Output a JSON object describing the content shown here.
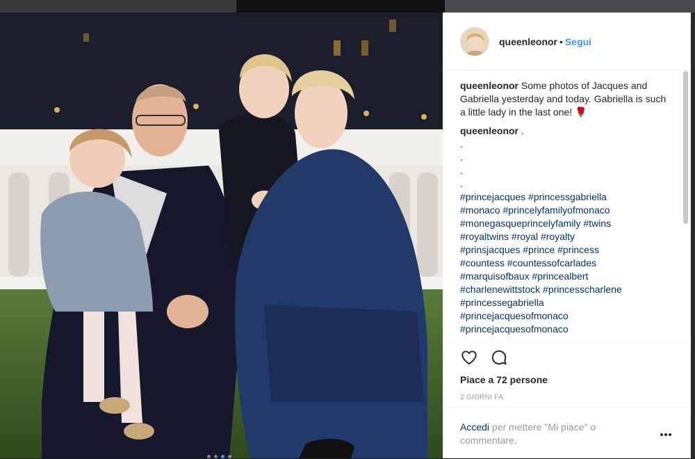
{
  "post": {
    "username": "queenleonor",
    "separator": "•",
    "follow_label": "Segui",
    "caption_user": "queenleonor",
    "caption_text": "Some photos of Jacques and Gabriella yesterday and today. Gabriella is such a little lady in the last one! 🌹",
    "comment_user": "queenleonor",
    "comment_first": ".",
    "comment_dots": [
      ".",
      ".",
      ".",
      "."
    ],
    "hashtags": [
      "#princejacques #princessgabriella",
      "#monaco #princelyfamilyofmonaco",
      "#monegasqueprincelyfamily #twins",
      "#royaltwins #royal #royalty",
      "#prinsjacques #prince #princess",
      "#countess #countessofcarlades",
      "#marquisofbaux #princealbert",
      "#charlenewittstock #princesscharlene",
      "#princessegabriella",
      "#princejacquesofmonaco",
      "#princejacquesofmonaco"
    ],
    "likes_text": "Piace a 72 persone",
    "time_text": "2 GIORNI FA",
    "login_link": "Accedi",
    "login_rest": " per mettere \"Mi piace\" o commentare.",
    "carousel": {
      "count": 4,
      "active_index": 2
    },
    "icons": {
      "like": "heart-outline-icon",
      "comment": "speech-bubble-icon",
      "more": "ellipsis-icon"
    },
    "colors": {
      "link_blue": "#3897f0",
      "hashtag_navy": "#003569",
      "text": "#262626",
      "muted": "#999999"
    }
  }
}
